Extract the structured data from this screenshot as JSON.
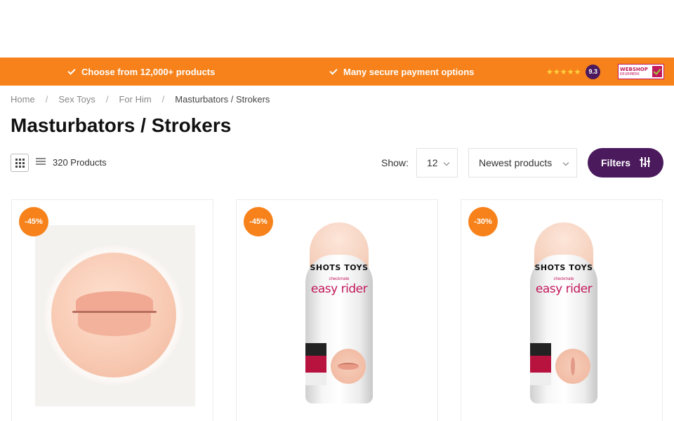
{
  "usp_bar": {
    "item1": "Choose from 12,000+ products",
    "item2": "Many secure payment options",
    "stars": "★★★★★",
    "score": "9.3",
    "keurmerk_line1": "WEBSHOP",
    "keurmerk_line2": "KEURMERK",
    "colors": {
      "bar": "#f7821b",
      "score_bg": "#4b1a5e"
    }
  },
  "breadcrumb": {
    "items": [
      "Home",
      "Sex Toys",
      "For Him",
      "Masturbators / Strokers"
    ],
    "separator": "/"
  },
  "page_title": "Masturbators / Strokers",
  "toolbar": {
    "product_count": "320 Products",
    "show_label": "Show:",
    "show_value": "12",
    "sort_value": "Newest products",
    "filters_label": "Filters",
    "icons": [
      "grid-view-icon",
      "list-view-icon",
      "chevron-down-icon",
      "sliders-icon"
    ]
  },
  "products": [
    {
      "badge": "-45%",
      "image": "lips-stroker"
    },
    {
      "badge": "-45%",
      "logo": "SHOTS TOYS",
      "sub": "checkmate",
      "brand": "easy rider",
      "image": "bottle-mouth"
    },
    {
      "badge": "-30%",
      "logo": "SHOTS TOYS",
      "sub": "checkmate",
      "brand": "easy rider",
      "image": "bottle-vagina"
    }
  ],
  "colors": {
    "accent": "#f7821b",
    "primary_button": "#4a1a5c"
  }
}
